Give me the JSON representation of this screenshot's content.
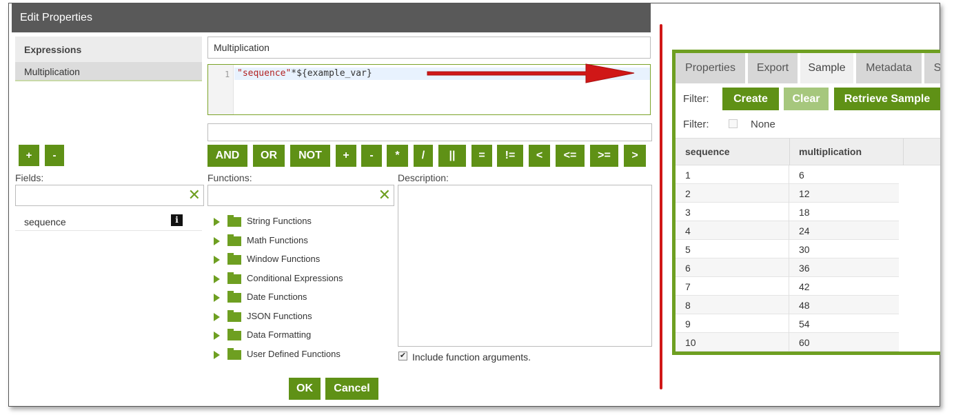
{
  "dialog": {
    "title": "Edit Properties",
    "expressions_header": "Expressions",
    "expressions": [
      "Multiplication"
    ],
    "name_value": "Multiplication",
    "code": {
      "line_number": "1",
      "string_token": "\"sequence\"",
      "rest_token": "*${example_var}"
    },
    "add_label": "+",
    "remove_label": "-",
    "operators": [
      "AND",
      "OR",
      "NOT",
      "+",
      "-",
      "*",
      "/",
      "||",
      "=",
      "!=",
      "<",
      "<=",
      ">=",
      ">"
    ],
    "fields_label": "Fields:",
    "functions_label": "Functions:",
    "description_label": "Description:",
    "fields": [
      {
        "name": "sequence",
        "info_icon": "info-icon"
      }
    ],
    "functions": [
      "String Functions",
      "Math Functions",
      "Window Functions",
      "Conditional Expressions",
      "Date Functions",
      "JSON Functions",
      "Data Formatting",
      "User Defined Functions"
    ],
    "include_args_label": "Include function arguments.",
    "include_args_checked": true,
    "ok_label": "OK",
    "cancel_label": "Cancel"
  },
  "sample_panel": {
    "tabs": [
      "Properties",
      "Export",
      "Sample",
      "Metadata",
      "S"
    ],
    "active_tab": "Sample",
    "filter_label": "Filter:",
    "create_label": "Create",
    "clear_label": "Clear",
    "retrieve_label": "Retrieve Sample",
    "filter2_label": "Filter:",
    "none_label": "None",
    "columns": [
      "sequence",
      "multiplication"
    ],
    "rows": [
      [
        "1",
        "6"
      ],
      [
        "2",
        "12"
      ],
      [
        "3",
        "18"
      ],
      [
        "4",
        "24"
      ],
      [
        "5",
        "30"
      ],
      [
        "6",
        "36"
      ],
      [
        "7",
        "42"
      ],
      [
        "8",
        "48"
      ],
      [
        "9",
        "54"
      ],
      [
        "10",
        "60"
      ]
    ]
  },
  "colors": {
    "accent_green": "#5f9116",
    "header_gray": "#595959",
    "annotation_red": "#d01717"
  }
}
